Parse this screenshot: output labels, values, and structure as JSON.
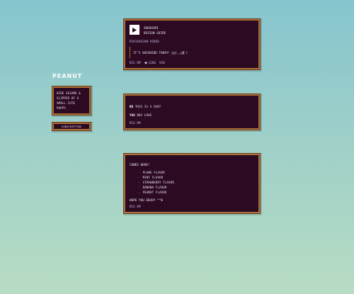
{
  "blog": {
    "title": "Peanut"
  },
  "sidebar": {
    "bio": "Hide sesame & slipper of a small cute puppy.",
    "subscribe_label": "Subscription"
  },
  "posts": [
    {
      "kind": "audio",
      "track_title": "Shoshimi",
      "track_artist": "Design Guide",
      "reblog_text": "Rikishisan-video",
      "quote": "It's shishido today! ゚ﾟ(,,ﾟДﾟ)",
      "footer": {
        "ago": "Rig 6m",
        "notes_count": "1206",
        "notes_label": "Vib"
      }
    },
    {
      "kind": "text",
      "line1_strong": "Rb",
      "line1_rest": "This is a chat",
      "line2_strong": "You",
      "line2_rest": "Box love",
      "footer": {
        "ago": "Rig 6m"
      }
    },
    {
      "kind": "text",
      "intro": "Cones here!",
      "flavors": [
        "Plane flavor",
        "Mint flavor",
        "Strawberry flavor",
        "Banana flavor",
        "Peanut flavor"
      ],
      "closing": "Hope you enjoy ^^b",
      "footer": {
        "ago": "Rig 6m"
      }
    }
  ],
  "icons": {
    "play": "play-icon",
    "heart": "heart-icon",
    "bullet": "-"
  },
  "colors": {
    "panel_bg": "#2b0a22",
    "panel_border": "#a8703a",
    "text": "#f0e3ff",
    "bg_top": "#86c5cf",
    "bg_bottom": "#b7dcc3"
  }
}
